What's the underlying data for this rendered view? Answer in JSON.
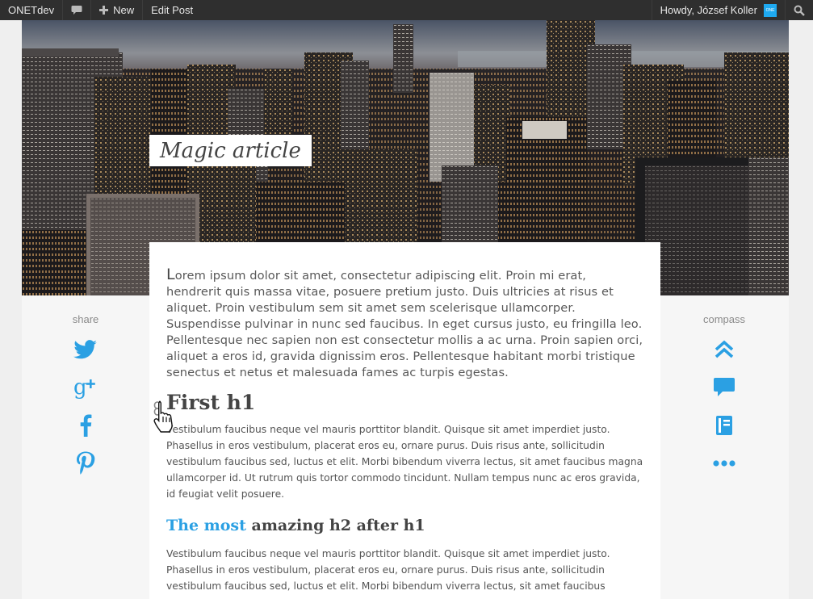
{
  "admin_bar": {
    "site_name": "ONETdev",
    "comments_icon": "speech-bubble-icon",
    "new_label": "New",
    "edit_post_label": "Edit Post",
    "greeting": "Howdy, József Koller",
    "avatar_text": "ONE",
    "search_icon": "search-icon"
  },
  "hero": {
    "title": "Magic article"
  },
  "share": {
    "label": "share",
    "icons": [
      "twitter-icon",
      "google-plus-icon",
      "facebook-icon",
      "pinterest-icon"
    ]
  },
  "compass": {
    "label": "compass",
    "icons": [
      "double-chevron-up-icon",
      "comment-icon",
      "book-icon",
      "more-dots-icon"
    ]
  },
  "article": {
    "lead": "Lorem ipsum dolor sit amet, consectetur adipiscing elit. Proin mi erat, hendrerit quis massa vitae, posuere pretium justo. Duis ultricies at risus et aliquet. Proin vestibulum sem sit amet sem scelerisque ullamcorper. Suspendisse pulvinar in nunc sed faucibus. In eget cursus justo, eu fringilla leo. Pellentesque nec sapien non est consectetur mollis a ac urna. Proin sapien orci, aliquet a eros id, gravida dignissim eros. Pellentesque habitant morbi tristique senectus et netus et malesuada fames ac turpis egestas.",
    "h1": "First h1",
    "para1": "Vestibulum faucibus neque vel mauris porttitor blandit. Quisque sit amet imperdiet justo. Phasellus in eros vestibulum, placerat eros eu, ornare purus. Duis risus ante, sollicitudin vestibulum faucibus sed, luctus et elit. Morbi bibendum viverra lectus, sit amet faucibus magna ullamcorper id. Ut rutrum quis tortor commodo tincidunt. Nullam tempus nunc ac eros gravida, id feugiat velit posuere.",
    "h2_accent": "The most",
    "h2_rest": " amazing h2 after h1",
    "para2": "Vestibulum faucibus neque vel mauris porttitor blandit. Quisque sit amet imperdiet justo. Phasellus in eros vestibulum, placerat eros eu, ornare purus. Duis risus ante, sollicitudin vestibulum faucibus sed, luctus et elit. Morbi bibendum viverra lectus, sit amet faucibus"
  },
  "colors": {
    "accent": "#2ba0e3",
    "admin_bar": "#2f2f2f"
  }
}
